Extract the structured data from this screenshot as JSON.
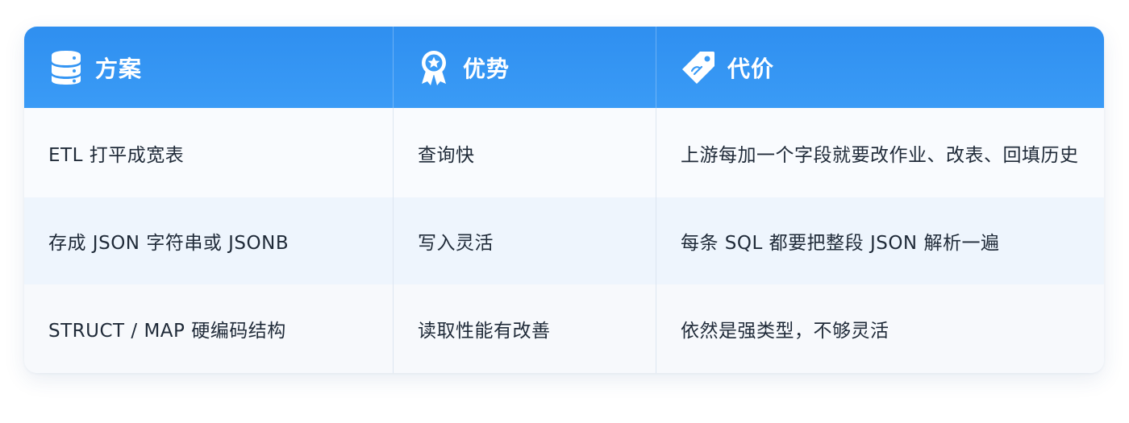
{
  "table": {
    "headers": [
      {
        "label": "方案",
        "icon": "database-icon"
      },
      {
        "label": "优势",
        "icon": "award-badge-icon"
      },
      {
        "label": "代价",
        "icon": "price-tag-icon"
      }
    ],
    "rows": [
      [
        "ETL 打平成宽表",
        "查询快",
        "上游每加一个字段就要改作业、改表、回填历史"
      ],
      [
        "存成 JSON 字符串或 JSONB",
        "写入灵活",
        "每条 SQL 都要把整段 JSON 解析一遍"
      ],
      [
        "STRUCT / MAP 硬编码结构",
        "读取性能有改善",
        "依然是强类型，不够灵活"
      ]
    ]
  },
  "colors": {
    "header_bg": "#3a9bf6",
    "header_text": "#ffffff",
    "body_text": "#1f2a38",
    "row_alt": "#eef5fd"
  }
}
